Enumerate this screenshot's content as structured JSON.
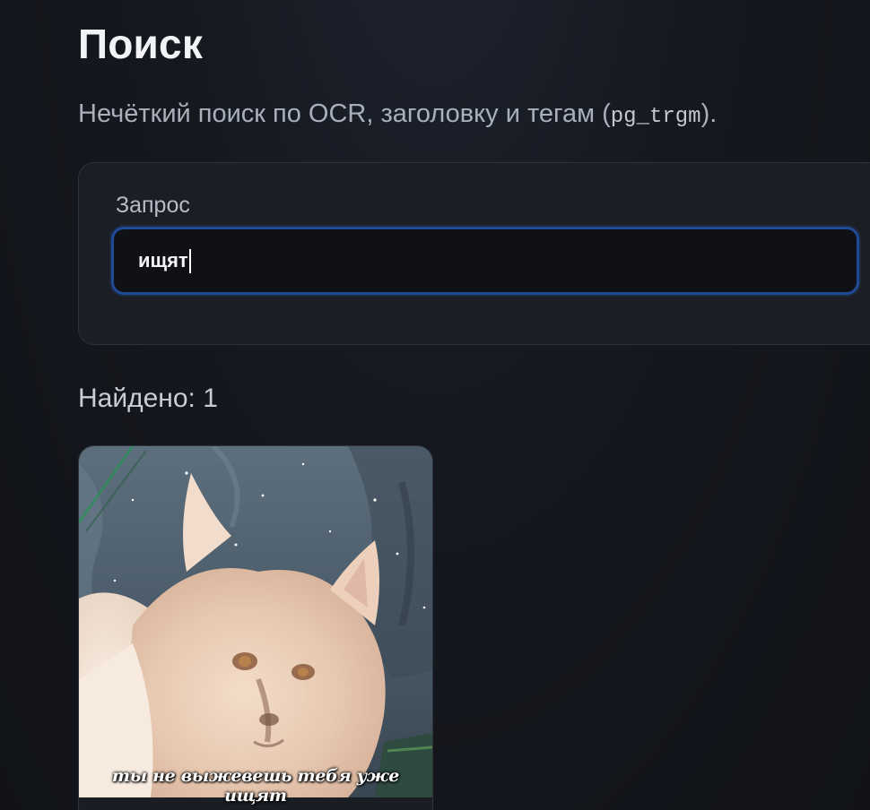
{
  "header": {
    "title": "Поиск",
    "subtitle_text": "Нечёткий поиск по OCR, заголовку и тегам (",
    "subtitle_code": "pg_trgm",
    "subtitle_suffix": ")."
  },
  "search": {
    "label": "Запрос",
    "value": "ищят"
  },
  "results": {
    "found_label": "Найдено: 1",
    "items": [
      {
        "caption": "ты не выжевешь тебя уже ищят"
      }
    ]
  },
  "colors": {
    "accent_border": "#1f4a95",
    "background": "#111318",
    "panel": "#1b1e25"
  }
}
